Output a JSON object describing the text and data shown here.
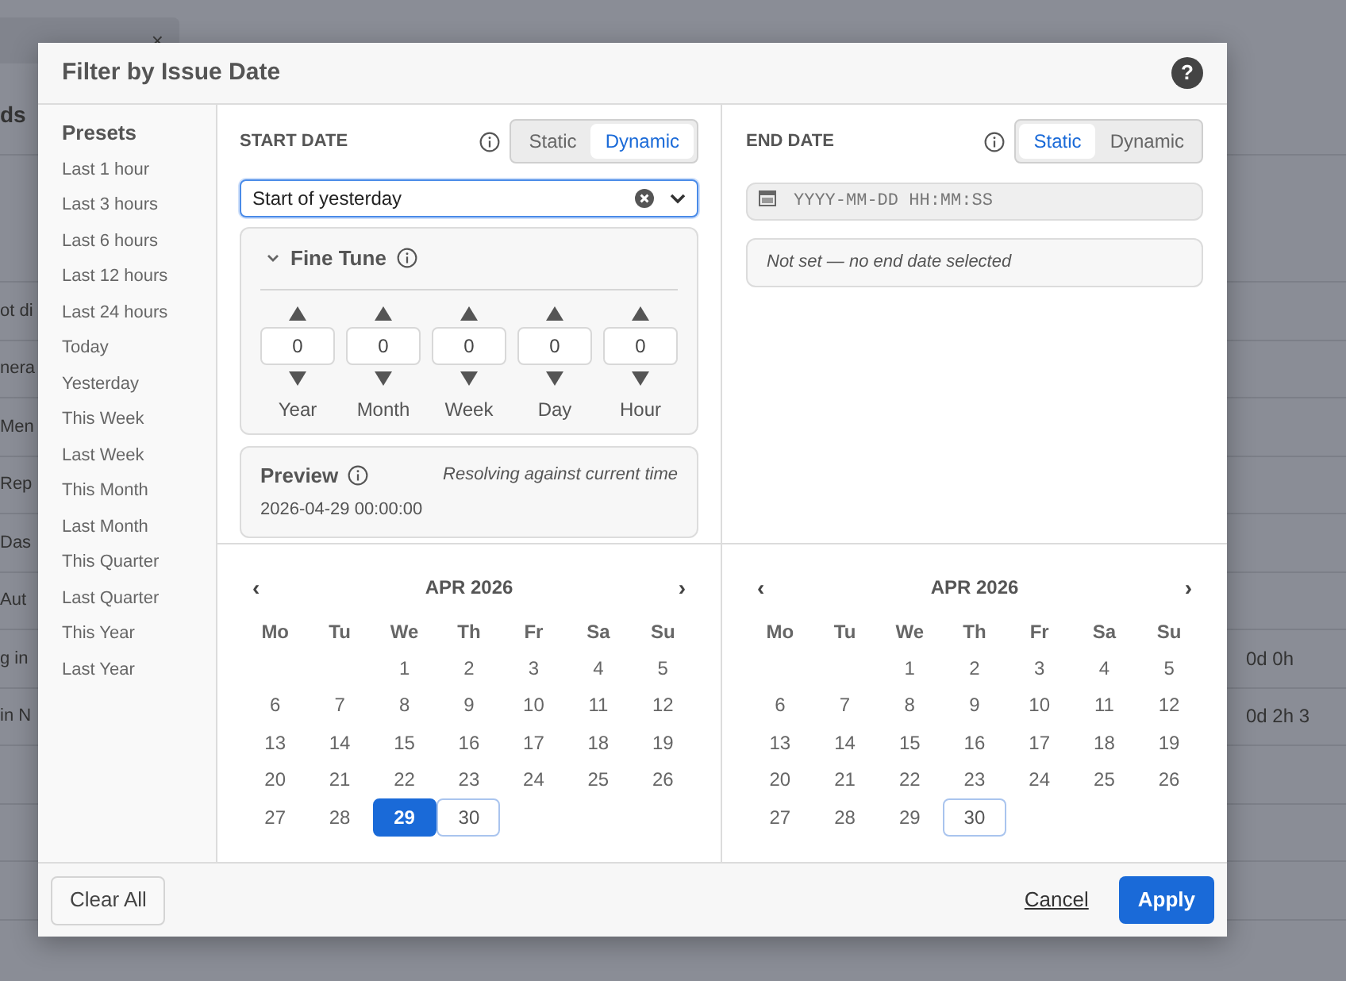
{
  "background": {
    "tab_close": "×",
    "heading": "ds",
    "rows": [
      {
        "left": "",
        "right": ""
      },
      {
        "left": "ot di",
        "right": ""
      },
      {
        "left": "nera",
        "right": ""
      },
      {
        "left": "Men",
        "right": ""
      },
      {
        "left": "Rep",
        "right": ""
      },
      {
        "left": "Das",
        "right": ""
      },
      {
        "left": "Aut",
        "right": ""
      },
      {
        "left": "g in",
        "right": "0d 0h"
      },
      {
        "left": "in N",
        "right": "0d 2h 3"
      },
      {
        "left": "",
        "right": ""
      },
      {
        "left": "",
        "right": ""
      },
      {
        "left": "",
        "right": ""
      }
    ]
  },
  "dialog": {
    "title": "Filter by Issue Date",
    "help": "?",
    "presets": {
      "title": "Presets",
      "items": [
        "Last 1 hour",
        "Last 3 hours",
        "Last 6 hours",
        "Last 12 hours",
        "Last 24 hours",
        "Today",
        "Yesterday",
        "This Week",
        "Last Week",
        "This Month",
        "Last Month",
        "This Quarter",
        "Last Quarter",
        "This Year",
        "Last Year"
      ]
    },
    "start": {
      "label": "START DATE",
      "modes": [
        {
          "label": "Static",
          "selected": false
        },
        {
          "label": "Dynamic",
          "selected": true
        }
      ],
      "kind": "dynamic",
      "value": "Start of yesterday",
      "fine_tune": {
        "title": "Fine Tune",
        "expanded": true,
        "units": [
          {
            "label": "Year",
            "value": "0"
          },
          {
            "label": "Month",
            "value": "0"
          },
          {
            "label": "Week",
            "value": "0"
          },
          {
            "label": "Day",
            "value": "0"
          },
          {
            "label": "Hour",
            "value": "0"
          }
        ]
      },
      "preview": {
        "title": "Preview",
        "note": "Resolving against current time",
        "value": "2026-04-29 00:00:00"
      },
      "calendar": {
        "prev": "‹",
        "next": "›",
        "month": "APR 2026",
        "weekdays": [
          "Mo",
          "Tu",
          "We",
          "Th",
          "Fr",
          "Sa",
          "Su"
        ],
        "days": [
          {
            "kind": "blank"
          },
          {
            "kind": "blank"
          },
          {
            "kind": "day",
            "label": "1",
            "selected": false,
            "today": false
          },
          {
            "kind": "day",
            "label": "2",
            "selected": false,
            "today": false
          },
          {
            "kind": "day",
            "label": "3",
            "selected": false,
            "today": false
          },
          {
            "kind": "day",
            "label": "4",
            "selected": false,
            "today": false
          },
          {
            "kind": "day",
            "label": "5",
            "selected": false,
            "today": false
          },
          {
            "kind": "day",
            "label": "6",
            "selected": false,
            "today": false
          },
          {
            "kind": "day",
            "label": "7",
            "selected": false,
            "today": false
          },
          {
            "kind": "day",
            "label": "8",
            "selected": false,
            "today": false
          },
          {
            "kind": "day",
            "label": "9",
            "selected": false,
            "today": false
          },
          {
            "kind": "day",
            "label": "10",
            "selected": false,
            "today": false
          },
          {
            "kind": "day",
            "label": "11",
            "selected": false,
            "today": false
          },
          {
            "kind": "day",
            "label": "12",
            "selected": false,
            "today": false
          },
          {
            "kind": "day",
            "label": "13",
            "selected": false,
            "today": false
          },
          {
            "kind": "day",
            "label": "14",
            "selected": false,
            "today": false
          },
          {
            "kind": "day",
            "label": "15",
            "selected": false,
            "today": false
          },
          {
            "kind": "day",
            "label": "16",
            "selected": false,
            "today": false
          },
          {
            "kind": "day",
            "label": "17",
            "selected": false,
            "today": false
          },
          {
            "kind": "day",
            "label": "18",
            "selected": false,
            "today": false
          },
          {
            "kind": "day",
            "label": "19",
            "selected": false,
            "today": false
          },
          {
            "kind": "day",
            "label": "20",
            "selected": false,
            "today": false
          },
          {
            "kind": "day",
            "label": "21",
            "selected": false,
            "today": false
          },
          {
            "kind": "day",
            "label": "22",
            "selected": false,
            "today": false
          },
          {
            "kind": "day",
            "label": "23",
            "selected": false,
            "today": false
          },
          {
            "kind": "day",
            "label": "24",
            "selected": false,
            "today": false
          },
          {
            "kind": "day",
            "label": "25",
            "selected": false,
            "today": false
          },
          {
            "kind": "day",
            "label": "26",
            "selected": false,
            "today": false
          },
          {
            "kind": "day",
            "label": "27",
            "selected": false,
            "today": false
          },
          {
            "kind": "day",
            "label": "28",
            "selected": false,
            "today": false
          },
          {
            "kind": "day",
            "label": "29",
            "selected": true,
            "today": false
          },
          {
            "kind": "day",
            "label": "30",
            "selected": false,
            "today": true
          }
        ]
      }
    },
    "end": {
      "label": "END DATE",
      "modes": [
        {
          "label": "Static",
          "selected": true
        },
        {
          "label": "Dynamic",
          "selected": false
        }
      ],
      "kind": "static",
      "placeholder": "YYYY-MM-DD HH:MM:SS",
      "status": "Not set — no end date selected",
      "calendar": {
        "prev": "‹",
        "next": "›",
        "month": "APR 2026",
        "weekdays": [
          "Mo",
          "Tu",
          "We",
          "Th",
          "Fr",
          "Sa",
          "Su"
        ],
        "days": [
          {
            "kind": "blank"
          },
          {
            "kind": "blank"
          },
          {
            "kind": "day",
            "label": "1",
            "selected": false,
            "today": false
          },
          {
            "kind": "day",
            "label": "2",
            "selected": false,
            "today": false
          },
          {
            "kind": "day",
            "label": "3",
            "selected": false,
            "today": false
          },
          {
            "kind": "day",
            "label": "4",
            "selected": false,
            "today": false
          },
          {
            "kind": "day",
            "label": "5",
            "selected": false,
            "today": false
          },
          {
            "kind": "day",
            "label": "6",
            "selected": false,
            "today": false
          },
          {
            "kind": "day",
            "label": "7",
            "selected": false,
            "today": false
          },
          {
            "kind": "day",
            "label": "8",
            "selected": false,
            "today": false
          },
          {
            "kind": "day",
            "label": "9",
            "selected": false,
            "today": false
          },
          {
            "kind": "day",
            "label": "10",
            "selected": false,
            "today": false
          },
          {
            "kind": "day",
            "label": "11",
            "selected": false,
            "today": false
          },
          {
            "kind": "day",
            "label": "12",
            "selected": false,
            "today": false
          },
          {
            "kind": "day",
            "label": "13",
            "selected": false,
            "today": false
          },
          {
            "kind": "day",
            "label": "14",
            "selected": false,
            "today": false
          },
          {
            "kind": "day",
            "label": "15",
            "selected": false,
            "today": false
          },
          {
            "kind": "day",
            "label": "16",
            "selected": false,
            "today": false
          },
          {
            "kind": "day",
            "label": "17",
            "selected": false,
            "today": false
          },
          {
            "kind": "day",
            "label": "18",
            "selected": false,
            "today": false
          },
          {
            "kind": "day",
            "label": "19",
            "selected": false,
            "today": false
          },
          {
            "kind": "day",
            "label": "20",
            "selected": false,
            "today": false
          },
          {
            "kind": "day",
            "label": "21",
            "selected": false,
            "today": false
          },
          {
            "kind": "day",
            "label": "22",
            "selected": false,
            "today": false
          },
          {
            "kind": "day",
            "label": "23",
            "selected": false,
            "today": false
          },
          {
            "kind": "day",
            "label": "24",
            "selected": false,
            "today": false
          },
          {
            "kind": "day",
            "label": "25",
            "selected": false,
            "today": false
          },
          {
            "kind": "day",
            "label": "26",
            "selected": false,
            "today": false
          },
          {
            "kind": "day",
            "label": "27",
            "selected": false,
            "today": false
          },
          {
            "kind": "day",
            "label": "28",
            "selected": false,
            "today": false
          },
          {
            "kind": "day",
            "label": "29",
            "selected": false,
            "today": false
          },
          {
            "kind": "day",
            "label": "30",
            "selected": false,
            "today": true
          }
        ]
      }
    },
    "footer": {
      "clear": "Clear All",
      "cancel": "Cancel",
      "apply": "Apply"
    }
  }
}
